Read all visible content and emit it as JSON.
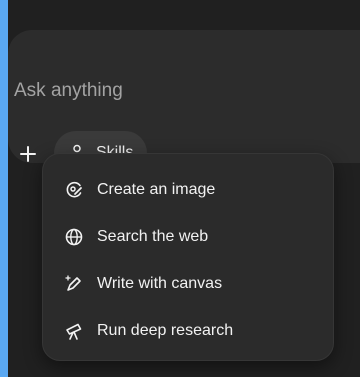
{
  "composer": {
    "placeholder": "Ask anything",
    "plus_icon": "plus-icon",
    "skills_button": {
      "label": "Skills",
      "icon": "skills-icon"
    }
  },
  "skills_menu": {
    "items": [
      {
        "label": "Create an image",
        "icon": "image-create-icon"
      },
      {
        "label": "Search the web",
        "icon": "globe-icon"
      },
      {
        "label": "Write with canvas",
        "icon": "pen-sparkle-icon"
      },
      {
        "label": "Run deep research",
        "icon": "telescope-icon"
      }
    ]
  }
}
